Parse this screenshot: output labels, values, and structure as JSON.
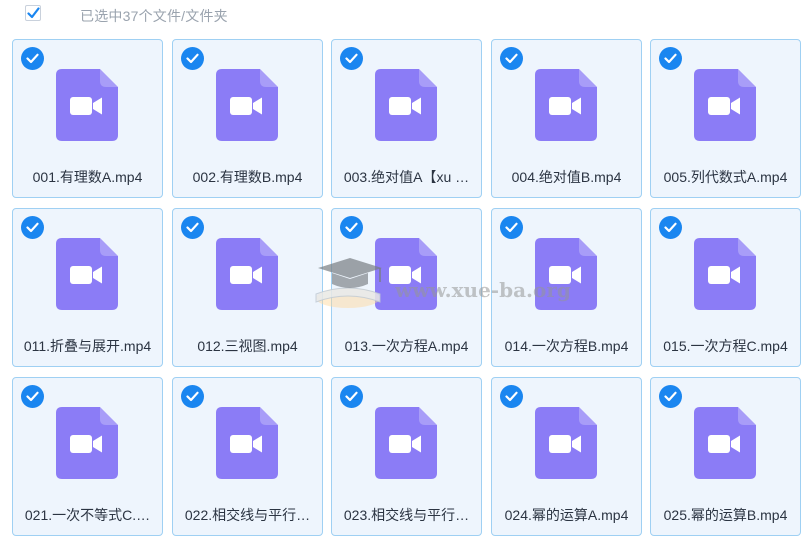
{
  "header": {
    "selection_label": "已选中37个文件/文件夹",
    "select_all_checked": true
  },
  "colors": {
    "accent": "#1a86f0",
    "card_border": "#9fd0f3",
    "card_bg": "#eef5fd",
    "video_icon": "#8b7cf6"
  },
  "files": [
    {
      "name": "001.有理数A.mp4",
      "selected": true,
      "icon": "video-file-icon"
    },
    {
      "name": "002.有理数B.mp4",
      "selected": true,
      "icon": "video-file-icon"
    },
    {
      "name": "003.绝对值A【xu …",
      "selected": true,
      "icon": "video-file-icon"
    },
    {
      "name": "004.绝对值B.mp4",
      "selected": true,
      "icon": "video-file-icon"
    },
    {
      "name": "005.列代数式A.mp4",
      "selected": true,
      "icon": "video-file-icon"
    },
    {
      "name": "011.折叠与展开.mp4",
      "selected": true,
      "icon": "video-file-icon"
    },
    {
      "name": "012.三视图.mp4",
      "selected": true,
      "icon": "video-file-icon"
    },
    {
      "name": "013.一次方程A.mp4",
      "selected": true,
      "icon": "video-file-icon"
    },
    {
      "name": "014.一次方程B.mp4",
      "selected": true,
      "icon": "video-file-icon"
    },
    {
      "name": "015.一次方程C.mp4",
      "selected": true,
      "icon": "video-file-icon"
    },
    {
      "name": "021.一次不等式C.…",
      "selected": true,
      "icon": "video-file-icon"
    },
    {
      "name": "022.相交线与平行…",
      "selected": true,
      "icon": "video-file-icon"
    },
    {
      "name": "023.相交线与平行…",
      "selected": true,
      "icon": "video-file-icon"
    },
    {
      "name": "024.幂的运算A.mp4",
      "selected": true,
      "icon": "video-file-icon"
    },
    {
      "name": "025.幂的运算B.mp4",
      "selected": true,
      "icon": "video-file-icon"
    }
  ],
  "watermark": {
    "text": "www.xue-ba.org",
    "icon": "graduation-cap-book-icon"
  }
}
